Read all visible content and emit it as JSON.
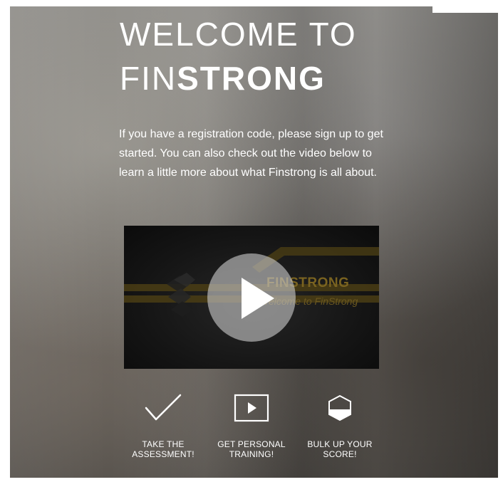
{
  "title": {
    "line1": "WELCOME TO",
    "line2_light": "FIN",
    "line2_bold": "STRONG"
  },
  "intro": {
    "text": "If you have a registration code, please sign up to get started. You can also check out the video below to learn a little more about what Finstrong is all about."
  },
  "video": {
    "brand": "FINSTRONG",
    "caption": "Welcome to FinStrong",
    "play_icon": "play-icon",
    "accent_color": "#7a6320"
  },
  "features": [
    {
      "icon": "checkmark-icon",
      "line1": "TAKE THE",
      "line2": "ASSESSMENT!"
    },
    {
      "icon": "video-play-icon",
      "line1": "GET PERSONAL",
      "line2": "TRAINING!"
    },
    {
      "icon": "hexagon-icon",
      "line1": "BULK UP YOUR",
      "line2": "SCORE!"
    }
  ]
}
